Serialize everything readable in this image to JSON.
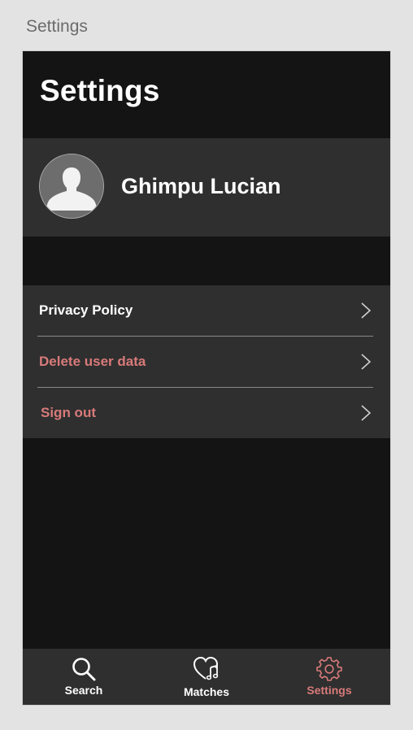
{
  "window": {
    "title": "Settings"
  },
  "header": {
    "title": "Settings"
  },
  "profile": {
    "name": "Ghimpu Lucian",
    "avatar_icon": "user-silhouette-icon"
  },
  "menu": {
    "items": [
      {
        "label": "Privacy Policy",
        "color": "#ffffff",
        "icon": "chevron-right-icon"
      },
      {
        "label": "Delete user data",
        "color": "#d97a7a",
        "icon": "chevron-right-icon"
      },
      {
        "label": "Sign out",
        "color": "#d97a7a",
        "icon": "chevron-right-icon"
      }
    ]
  },
  "tabbar": {
    "tabs": [
      {
        "label": "Search",
        "icon": "magnifier-icon",
        "active": false,
        "color": "#ffffff"
      },
      {
        "label": "Matches",
        "icon": "heart-music-icon",
        "active": false,
        "color": "#ffffff"
      },
      {
        "label": "Settings",
        "icon": "gear-icon",
        "active": true,
        "color": "#d97a7a"
      }
    ]
  },
  "colors": {
    "background": "#141414",
    "surface": "#2f2f2f",
    "accent": "#d97a7a",
    "text": "#ffffff"
  }
}
